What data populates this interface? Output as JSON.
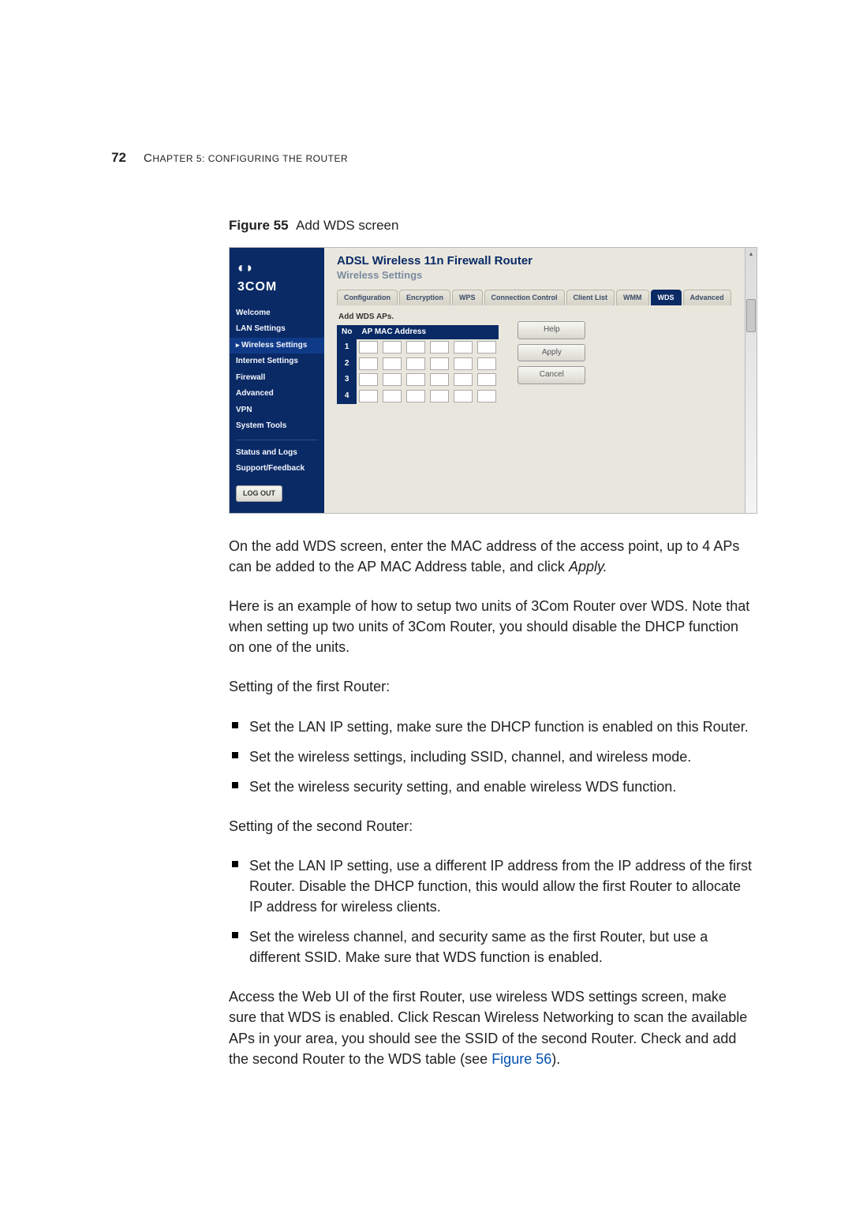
{
  "page_number": "72",
  "chapter_line_prefix": "C",
  "chapter_line_rest": "HAPTER 5: CONFIGURING THE ROUTER",
  "figure_caption_label": "Figure 55",
  "figure_caption_text": "Add WDS screen",
  "screenshot": {
    "logo_text": "3COM",
    "title": "ADSL Wireless 11n Firewall Router",
    "subtitle": "Wireless Settings",
    "tabs": [
      "Configuration",
      "Encryption",
      "WPS",
      "Connection Control",
      "Client List",
      "WMM",
      "WDS",
      "Advanced"
    ],
    "active_tab_index": 6,
    "nav": [
      "Welcome",
      "LAN Settings",
      "Wireless Settings",
      "Internet Settings",
      "Firewall",
      "Advanced",
      "VPN",
      "System Tools"
    ],
    "nav2": [
      "Status and Logs",
      "Support/Feedback"
    ],
    "active_nav_index": 2,
    "logout": "LOG OUT",
    "table_label": "Add WDS APs.",
    "col_no": "No",
    "col_mac": "AP MAC Address",
    "rows": [
      "1",
      "2",
      "3",
      "4"
    ],
    "buttons": [
      "Help",
      "Apply",
      "Cancel"
    ]
  },
  "para1": "On the add WDS screen, enter the MAC address of the access point, up to 4 APs can be added to the AP MAC Address table, and click ",
  "para1_apply": "Apply.",
  "para2": "Here is an example of how to setup two units of 3Com Router over WDS. Note that when setting up two units of 3Com Router, you should disable the DHCP function on one of the units.",
  "para3": "Setting of the first Router:",
  "list1": [
    "Set the LAN IP setting, make sure the DHCP function is enabled on this Router.",
    "Set the wireless settings, including SSID, channel, and wireless mode.",
    "Set the wireless security setting, and enable wireless WDS function."
  ],
  "para4": "Setting of the second Router:",
  "list2": [
    "Set the LAN IP setting, use a different IP address from the IP address of the first Router. Disable the DHCP function, this would allow the first Router to allocate IP address for wireless clients.",
    "Set the wireless channel, and security same as the first Router, but use a different SSID. Make sure that WDS function is enabled."
  ],
  "para5_a": "Access the Web UI of the first Router, use wireless WDS settings screen, make sure that WDS is enabled. Click Rescan Wireless Networking to scan the available APs in your area, you should see the SSID of the second Router. Check and add the second Router to the WDS table (see ",
  "para5_link": "Figure 56",
  "para5_b": ")."
}
